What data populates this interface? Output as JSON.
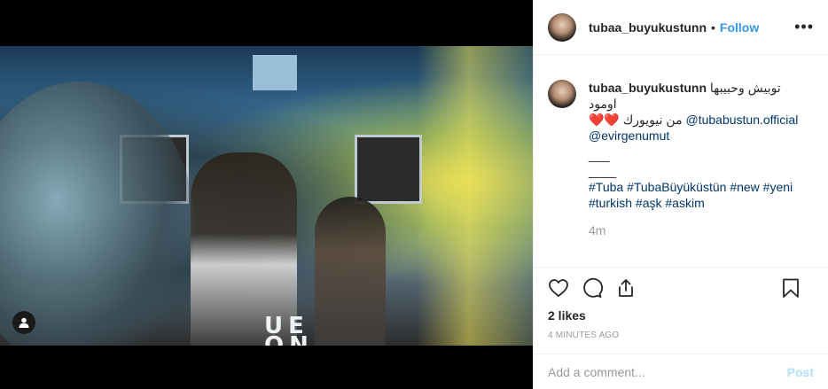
{
  "author": {
    "username": "tubaa_buyukustunn",
    "follow_label": "Follow",
    "separator": "•"
  },
  "header": {
    "more_label": "•••"
  },
  "caption": {
    "username": "tubaa_buyukustunn",
    "line1": "توبيش وحبيبها اومود",
    "line2": "من نيويورك ❤️❤️",
    "mention1": "@tubabustun.official",
    "mention2": "@evirgenumut",
    "sep1": "___",
    "sep2": "____",
    "hashtags": [
      "#Tuba",
      "#TubaBüyüküstün",
      "#new",
      "#yeni",
      "#turkish",
      "#aşk",
      "#askim"
    ],
    "time": "4m"
  },
  "photo": {
    "shirt_text_1": "UE",
    "shirt_text_2": "ON"
  },
  "likes": "2 likes",
  "time_ago": "4 MINUTES AGO",
  "comment": {
    "placeholder": "Add a comment...",
    "post_label": "Post"
  },
  "icons": [
    "user-tag-icon",
    "heart-icon",
    "comment-icon",
    "share-icon",
    "bookmark-icon",
    "more-options-icon"
  ]
}
